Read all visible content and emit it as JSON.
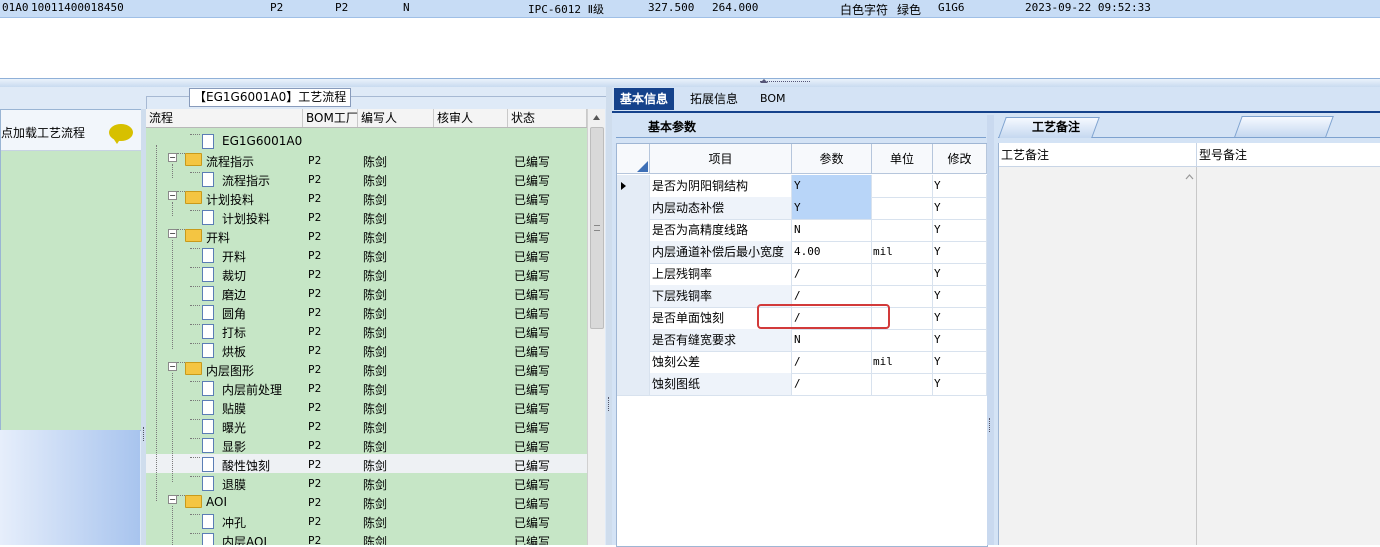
{
  "top_row": {
    "cells": [
      "01A0",
      "10011400018450",
      "P2",
      "P2",
      "N",
      "IPC-6012 Ⅱ级",
      "327.500",
      "264.000",
      "白色字符",
      "绿色",
      "G1G6",
      "2023-09-22 09:52:33"
    ]
  },
  "left_panel": {
    "load_text": "点加载工艺流程"
  },
  "process_panel": {
    "title": "【EG1G6001A0】工艺流程",
    "columns": [
      "流程",
      "BOM工厂",
      "编写人",
      "核审人",
      "状态"
    ],
    "rows": [
      {
        "label": "EG1G6001A0",
        "bom": "",
        "writer": "",
        "status": ""
      },
      {
        "label": "流程指示",
        "bom": "P2",
        "writer": "陈剑",
        "status": "已编写"
      },
      {
        "label": "流程指示",
        "bom": "P2",
        "writer": "陈剑",
        "status": "已编写"
      },
      {
        "label": "计划投料",
        "bom": "P2",
        "writer": "陈剑",
        "status": "已编写"
      },
      {
        "label": "计划投料",
        "bom": "P2",
        "writer": "陈剑",
        "status": "已编写"
      },
      {
        "label": "开料",
        "bom": "P2",
        "writer": "陈剑",
        "status": "已编写"
      },
      {
        "label": "开料",
        "bom": "P2",
        "writer": "陈剑",
        "status": "已编写"
      },
      {
        "label": "裁切",
        "bom": "P2",
        "writer": "陈剑",
        "status": "已编写"
      },
      {
        "label": "磨边",
        "bom": "P2",
        "writer": "陈剑",
        "status": "已编写"
      },
      {
        "label": "圆角",
        "bom": "P2",
        "writer": "陈剑",
        "status": "已编写"
      },
      {
        "label": "打标",
        "bom": "P2",
        "writer": "陈剑",
        "status": "已编写"
      },
      {
        "label": "烘板",
        "bom": "P2",
        "writer": "陈剑",
        "status": "已编写"
      },
      {
        "label": "内层图形",
        "bom": "P2",
        "writer": "陈剑",
        "status": "已编写"
      },
      {
        "label": "内层前处理",
        "bom": "P2",
        "writer": "陈剑",
        "status": "已编写"
      },
      {
        "label": "贴膜",
        "bom": "P2",
        "writer": "陈剑",
        "status": "已编写"
      },
      {
        "label": "曝光",
        "bom": "P2",
        "writer": "陈剑",
        "status": "已编写"
      },
      {
        "label": "显影",
        "bom": "P2",
        "writer": "陈剑",
        "status": "已编写"
      },
      {
        "label": "酸性蚀刻",
        "bom": "P2",
        "writer": "陈剑",
        "status": "已编写"
      },
      {
        "label": "退膜",
        "bom": "P2",
        "writer": "陈剑",
        "status": "已编写"
      },
      {
        "label": "AOI",
        "bom": "P2",
        "writer": "陈剑",
        "status": "已编写"
      },
      {
        "label": "冲孔",
        "bom": "P2",
        "writer": "陈剑",
        "status": "已编写"
      },
      {
        "label": "内层AOI",
        "bom": "P2",
        "writer": "陈剑",
        "status": "已编写"
      }
    ]
  },
  "tabs": [
    "基本信息",
    "拓展信息",
    "BOM"
  ],
  "basic_params": {
    "title": "基本参数",
    "columns": [
      "项目",
      "参数",
      "单位",
      "修改"
    ],
    "rows": [
      {
        "name": "是否为阴阳铜结构",
        "value": "Y",
        "unit": "",
        "modify": "Y"
      },
      {
        "name": "内层动态补偿",
        "value": "Y",
        "unit": "",
        "modify": "Y"
      },
      {
        "name": "是否为高精度线路",
        "value": "N",
        "unit": "",
        "modify": "Y"
      },
      {
        "name": "内层通道补偿后最小宽度",
        "value": "4.00",
        "unit": "mil",
        "modify": "Y"
      },
      {
        "name": "上层残铜率",
        "value": "/",
        "unit": "",
        "modify": "Y"
      },
      {
        "name": "下层残铜率",
        "value": "/",
        "unit": "",
        "modify": "Y"
      },
      {
        "name": "是否单面蚀刻",
        "value": "/",
        "unit": "",
        "modify": "Y"
      },
      {
        "name": "是否有缝宽要求",
        "value": "N",
        "unit": "",
        "modify": "Y"
      },
      {
        "name": "蚀刻公差",
        "value": "/",
        "unit": "mil",
        "modify": "Y"
      },
      {
        "name": "蚀刻图纸",
        "value": "/",
        "unit": "",
        "modify": "Y"
      }
    ]
  },
  "process_notes": {
    "title": "工艺备注",
    "columns": [
      "工艺备注",
      "型号备注"
    ]
  },
  "colors": {
    "tab_active": "#15428b",
    "tree_bg": "#c6e6c6",
    "highlight": "#d23a3a"
  }
}
